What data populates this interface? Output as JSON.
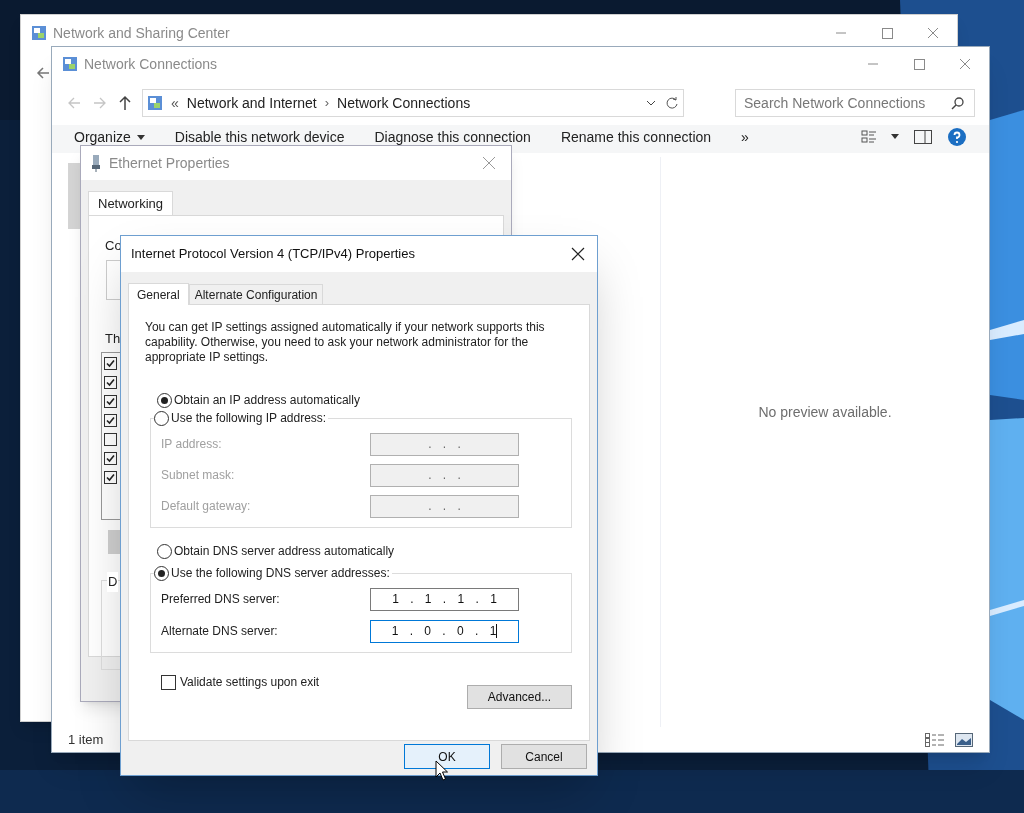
{
  "background_window": {
    "title": "Network and Sharing Center"
  },
  "explorer": {
    "title": "Network Connections",
    "breadcrumb": [
      {
        "kind": "chevron",
        "text": "«"
      },
      {
        "kind": "crumb",
        "text": "Network and Internet"
      },
      {
        "kind": "separator",
        "text": "›"
      },
      {
        "kind": "crumb",
        "text": "Network Connections"
      }
    ],
    "search": {
      "placeholder": "Search Network Connections"
    },
    "toolbar": [
      {
        "kind": "menu",
        "text": "Organize"
      },
      {
        "kind": "command",
        "text": "Disable this network device"
      },
      {
        "kind": "command",
        "text": "Diagnose this connection"
      },
      {
        "kind": "command",
        "text": "Rename this connection"
      },
      {
        "kind": "more",
        "text": "»"
      }
    ],
    "preview": "No preview available.",
    "status_bar": "1 item"
  },
  "ethernet": {
    "title": "Ethernet Properties",
    "tabs": [
      {
        "label": "Networking",
        "selected": true
      }
    ],
    "label_1": "Co",
    "label_2": "Th",
    "label_3": "D",
    "components": [
      {
        "checked": true
      },
      {
        "checked": true
      },
      {
        "checked": true
      },
      {
        "checked": true
      },
      {
        "checked": false
      },
      {
        "checked": true
      },
      {
        "checked": true
      }
    ]
  },
  "ipv4": {
    "title": "Internet Protocol Version 4 (TCP/IPv4) Properties",
    "tabs": [
      {
        "label": "General",
        "selected": true
      },
      {
        "label": "Alternate Configuration",
        "selected": false
      }
    ],
    "description": "You can get IP settings assigned automatically if your network supports this capability. Otherwise, you need to ask your network administrator for the appropriate IP settings.",
    "ip_auto": {
      "label": "Obtain an IP address automatically",
      "selected": true
    },
    "ip_manual": {
      "label": "Use the following IP address:",
      "selected": false
    },
    "ip_fields": [
      {
        "label": "IP address:",
        "value": ". . .",
        "disabled": true
      },
      {
        "label": "Subnet mask:",
        "value": ". . .",
        "disabled": true
      },
      {
        "label": "Default gateway:",
        "value": ". . .",
        "disabled": true
      }
    ],
    "dns_auto": {
      "label": "Obtain DNS server address automatically",
      "selected": false
    },
    "dns_manual": {
      "label": "Use the following DNS server addresses:",
      "selected": true
    },
    "dns_fields": [
      {
        "label": "Preferred DNS server:",
        "value": "1 . 1 . 1 . 1",
        "disabled": false,
        "focused": false
      },
      {
        "label": "Alternate DNS server:",
        "value": "1 . 0 . 0 . 1",
        "disabled": false,
        "focused": true
      }
    ],
    "validate": {
      "label": "Validate settings upon exit",
      "checked": false
    },
    "advanced": "Advanced...",
    "ok": "OK",
    "cancel": "Cancel"
  }
}
